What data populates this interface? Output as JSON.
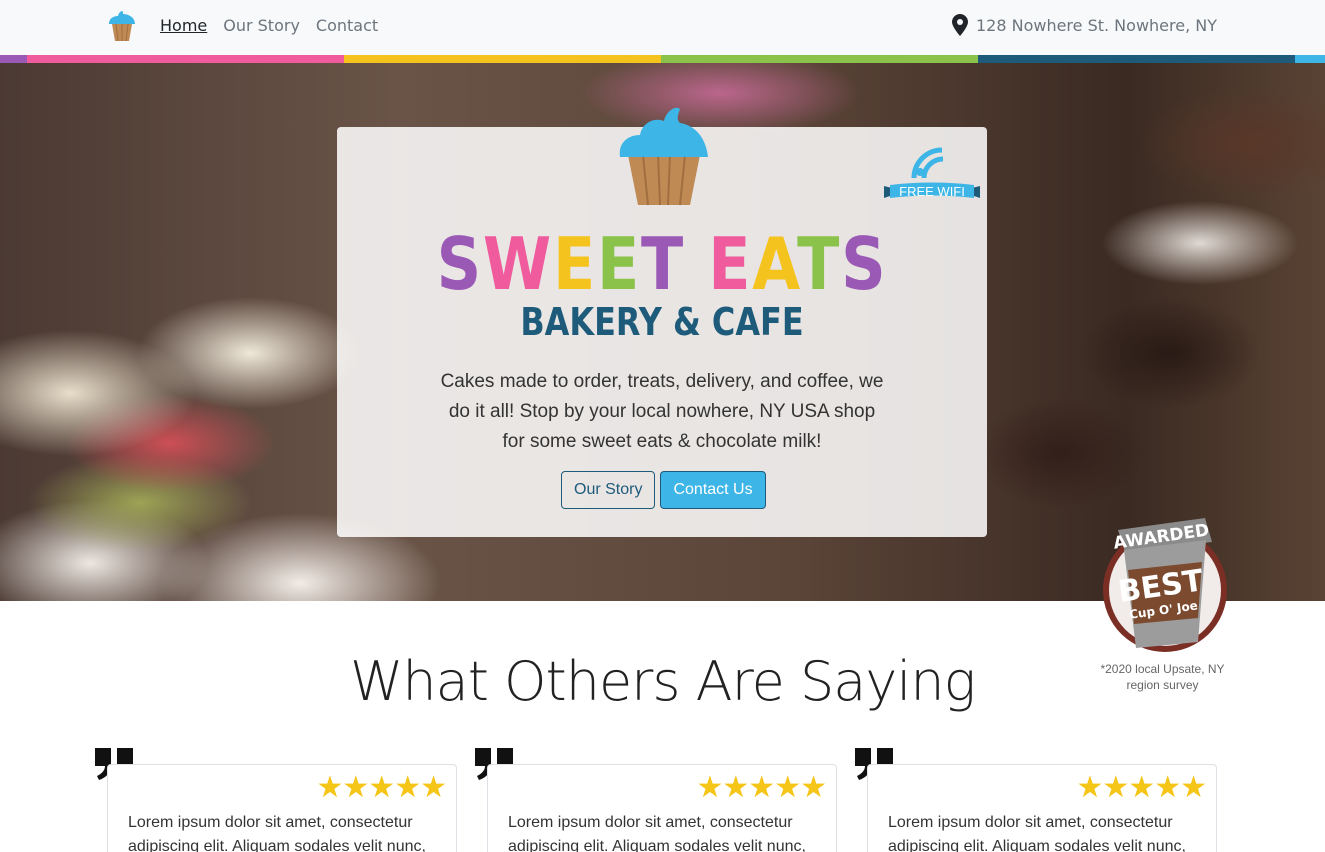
{
  "nav": {
    "links": [
      {
        "label": "Home",
        "active": true
      },
      {
        "label": "Our Story",
        "active": false
      },
      {
        "label": "Contact",
        "active": false
      }
    ],
    "address": "128 Nowhere St. Nowhere, NY"
  },
  "stripe_colors": [
    "#9b59b6",
    "#ef5b9c",
    "#f5c31e",
    "#8bc34a",
    "#1e5b7a",
    "#3db5e6"
  ],
  "hero": {
    "brand_title_letters": [
      {
        "ch": "S",
        "color": "#9b59b6"
      },
      {
        "ch": "W",
        "color": "#ef5b9c"
      },
      {
        "ch": "E",
        "color": "#f5c31e"
      },
      {
        "ch": "E",
        "color": "#8bc34a"
      },
      {
        "ch": "T",
        "color": "#9b59b6"
      },
      {
        "ch": " ",
        "color": "#000000"
      },
      {
        "ch": "E",
        "color": "#ef5b9c"
      },
      {
        "ch": "A",
        "color": "#f5c31e"
      },
      {
        "ch": "T",
        "color": "#8bc34a"
      },
      {
        "ch": "S",
        "color": "#9b59b6"
      }
    ],
    "brand_subtitle": "BAKERY & CAFE",
    "wifi_label": "FREE WIFI",
    "description": "Cakes made to order, treats, delivery, and coffee, we do it all! Stop by your local nowhere, NY USA shop for some sweet eats & chocolate milk!",
    "buttons": {
      "story": "Our Story",
      "contact": "Contact Us"
    }
  },
  "award": {
    "top": "AWARDED",
    "main": "BEST",
    "sub": "Cup O' Joe",
    "note": "*2020 local Upsate, NY region survey"
  },
  "testimonials": {
    "title": "What Others Are Saying",
    "items": [
      {
        "stars": "★★★★★",
        "text": "Lorem ipsum dolor sit amet, consectetur adipiscing elit. Aliquam sodales velit nunc,"
      },
      {
        "stars": "★★★★★",
        "text": "Lorem ipsum dolor sit amet, consectetur adipiscing elit. Aliquam sodales velit nunc,"
      },
      {
        "stars": "★★★★★",
        "text": "Lorem ipsum dolor sit amet, consectetur adipiscing elit. Aliquam sodales velit nunc,"
      }
    ]
  },
  "icons": {
    "logo": "cupcake-icon",
    "address": "map-pin-icon",
    "wifi": "wifi-icon",
    "quote": "quote-icon",
    "rating": "star-icon"
  }
}
